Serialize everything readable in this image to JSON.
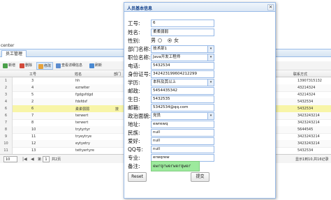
{
  "background": {
    "section_title": "center",
    "tab_label": "员工管理",
    "toolbar": [
      {
        "label": "新增",
        "icon": "add-icon",
        "color": "#4aa04a"
      },
      {
        "label": "删除",
        "icon": "delete-icon",
        "color": "#d24a3a"
      },
      {
        "label": "修改",
        "icon": "edit-icon",
        "color": "#e6a23c"
      },
      {
        "label": "查看详细信息",
        "icon": "view-icon",
        "color": "#5b8ccf"
      },
      {
        "label": "刷新",
        "icon": "refresh-icon",
        "color": "#4a8ad2"
      }
    ],
    "columns": {
      "col1": "工号",
      "col2": "姓名",
      "col3": "部门",
      "col6": "联系方式"
    },
    "rows": [
      {
        "num": "1",
        "id": "3",
        "name": "hh",
        "dept": "",
        "phone": "13907315132"
      },
      {
        "num": "2",
        "id": "4",
        "name": "ezrwiter",
        "dept": "",
        "phone": "43214324"
      },
      {
        "num": "3",
        "id": "5",
        "name": "fgdgsfdgd",
        "dept": "",
        "phone": "43214324"
      },
      {
        "num": "4",
        "id": "2",
        "name": "fdsfdsf",
        "dept": "",
        "phone": "5432534"
      },
      {
        "num": "6",
        "id": "6",
        "name": "柔柔弱弱",
        "dept": "技",
        "phone": "5432534"
      },
      {
        "num": "6",
        "id": "7",
        "name": "terwert",
        "dept": "",
        "phone": "3423243214"
      },
      {
        "num": "7",
        "id": "8",
        "name": "terwert",
        "dept": "",
        "phone": "3423243214"
      },
      {
        "num": "8",
        "id": "10",
        "name": "trytyrtyr",
        "dept": "",
        "phone": "5644545"
      },
      {
        "num": "9",
        "id": "11",
        "name": "tryeytrye",
        "dept": "",
        "phone": "3423243214"
      },
      {
        "num": "10",
        "id": "12",
        "name": "eytyetry",
        "dept": "",
        "phone": "3423243214"
      },
      {
        "num": "11",
        "id": "13",
        "name": "tettyertyre",
        "dept": "",
        "phone": "5432534"
      }
    ],
    "pager": {
      "page_size": "10",
      "page": "1",
      "total_pages": "共2页",
      "summary": "显示1到10,共16记录"
    }
  },
  "dialog": {
    "title": "人员基本信息",
    "fields": {
      "id": {
        "label": "工号:",
        "value": "6"
      },
      "name": {
        "label": "姓名:",
        "value": "柔柔弱弱"
      },
      "gender": {
        "label": "性别:",
        "male": "男",
        "female": "女"
      },
      "dept": {
        "label": "部门名称:",
        "value": "技术部1"
      },
      "position": {
        "label": "职位名称:",
        "value": "Java开发工程师"
      },
      "phone": {
        "label": "电话:",
        "value": "5432534"
      },
      "idcard": {
        "label": "身份证号:",
        "value": "342423199604212299"
      },
      "education": {
        "label": "学历:",
        "value": "本科及其以上"
      },
      "postcode": {
        "label": "邮政:",
        "value": "5454435342"
      },
      "birthday": {
        "label": "生日:",
        "value": "5432535"
      },
      "email": {
        "label": "邮箱:",
        "value": "5342534@qq.com"
      },
      "politics": {
        "label": "政治面貌:",
        "value": "党员"
      },
      "address": {
        "label": "地址:",
        "value": "ewrewq"
      },
      "nation": {
        "label": "民族:",
        "value": "null"
      },
      "hobby": {
        "label": "爱好:",
        "value": "null"
      },
      "qq": {
        "label": "QQ号:",
        "value": "null"
      },
      "major": {
        "label": "专业:",
        "value": "erwqrew"
      },
      "remark": {
        "label": "备注:",
        "value": "ewrqrwerwerqwer"
      }
    },
    "reset_label": "Reset",
    "submit_label": "提交"
  }
}
